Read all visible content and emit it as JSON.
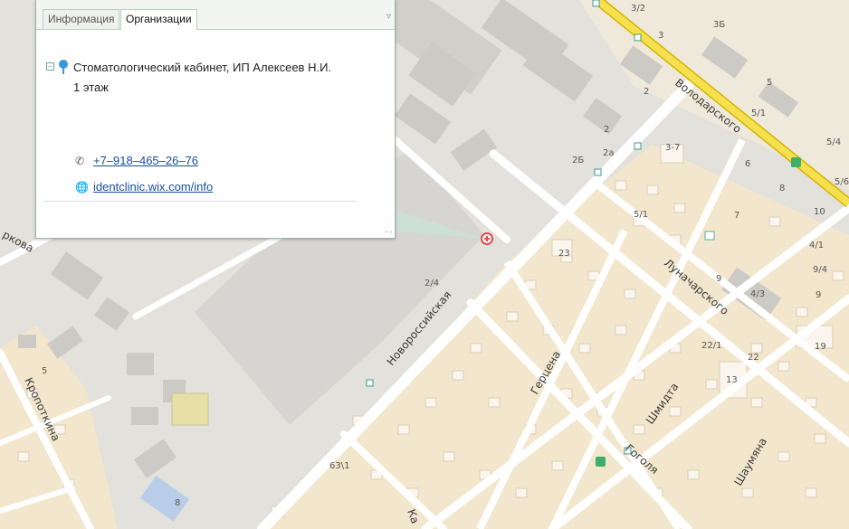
{
  "popup": {
    "tabs": [
      "Информация",
      "Организации"
    ],
    "active_tab": "Организации",
    "collapse_icon": "chevron-down-icon",
    "organization": {
      "name": "Стоматологический кабинет, ИП Алексеев Н.И.",
      "floor": "1 этаж",
      "phone": "+7–918–465–26–76",
      "website": "identclinic.wix.com/info"
    }
  },
  "map": {
    "streets": {
      "volodarskogo": "Володарского",
      "novorossiyskaya": "Новороссийская",
      "lunacharskogo": "Луначарского",
      "gertsena": "Герцена",
      "shmidta": "Шмидта",
      "gogolya": "Гоголя",
      "shaumyana": "Шаумяна",
      "kropotkina": "Кропоткина",
      "fragment_left": "ркова",
      "fragment_bottom": "Ка"
    },
    "house_numbers": {
      "n3_2": "3/2",
      "n3": "3",
      "n3b": "3Б",
      "n5a": "5",
      "n5_1a": "5/1",
      "n5_4": "5/4",
      "n2a": "2",
      "n2b": "2",
      "n2_a": "2а",
      "n2B": "2Б",
      "n3_7": "3-7",
      "n6": "6",
      "n8a": "8",
      "n10": "10",
      "n5_6": "5/6",
      "n7": "7",
      "n5_1b": "5/1",
      "n4_1": "4/1",
      "n9a": "9",
      "n9_4": "9/4",
      "n4_3": "4/3",
      "n9b": "9",
      "n23": "23",
      "n2_4": "2/4",
      "n22_1": "22/1",
      "n19": "19",
      "n22": "22",
      "n13": "13",
      "n5b": "5",
      "n63_1": "63\\1",
      "n8b": "8"
    },
    "colors": {
      "background": "#e3e1db",
      "residential": "#f2e7cd",
      "road": "#ffffff",
      "highway": "#f5e04f",
      "building": "#c9c8c2",
      "house": "#faf6ee"
    }
  }
}
